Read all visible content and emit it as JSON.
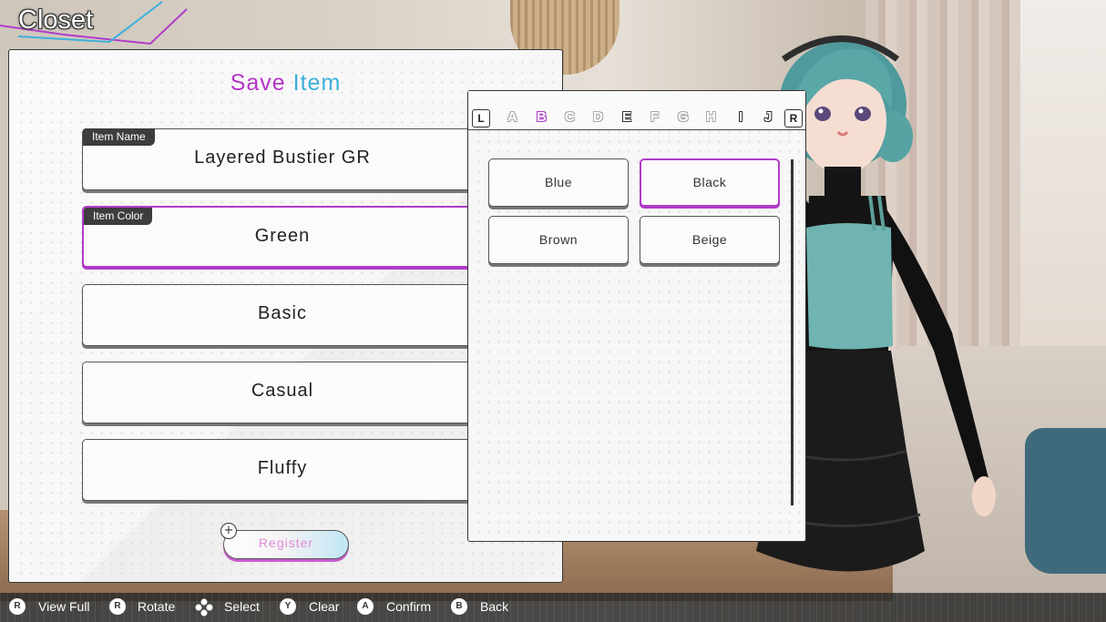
{
  "header": {
    "title": "Closet"
  },
  "save_panel": {
    "title_part1": "Save",
    "title_part2": "Item",
    "fields": [
      {
        "tag": "Item Name",
        "value": "Layered Bustier GR"
      },
      {
        "tag": "Item Color",
        "value": "Green"
      },
      {
        "tag": "",
        "value": "Basic"
      },
      {
        "tag": "",
        "value": "Casual"
      },
      {
        "tag": "",
        "value": "Fluffy"
      }
    ],
    "register_label": "Register",
    "register_icon": "+"
  },
  "color_picker": {
    "shoulder_left": "L",
    "shoulder_right": "R",
    "letters": [
      "A",
      "B",
      "C",
      "D",
      "E",
      "F",
      "G",
      "H",
      "I",
      "J"
    ],
    "active_letter": "B",
    "options": [
      "Blue",
      "Black",
      "Brown",
      "Beige"
    ],
    "selected_option": "Black"
  },
  "controls": [
    {
      "icon": "R",
      "label": "View Full"
    },
    {
      "icon": "R",
      "label": "Rotate"
    },
    {
      "icon": "dpad",
      "label": "Select"
    },
    {
      "icon": "Y",
      "label": "Clear"
    },
    {
      "icon": "A",
      "label": "Confirm"
    },
    {
      "icon": "B",
      "label": "Back"
    }
  ],
  "colors": {
    "accent_purple": "#b03cc8",
    "accent_cyan": "#3cb0dc",
    "item_top": "#6fb4b0",
    "hair": "#5aa7a8"
  }
}
